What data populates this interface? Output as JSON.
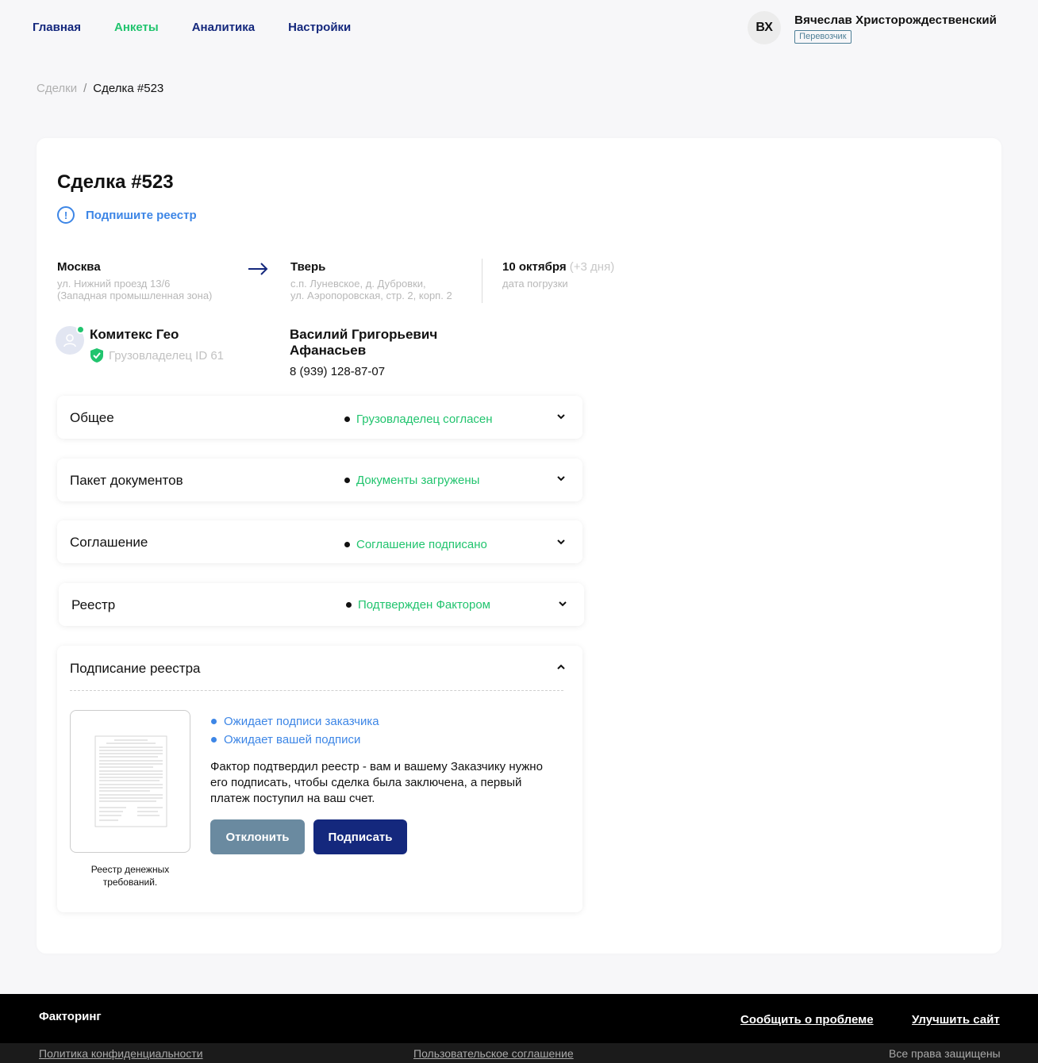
{
  "nav": {
    "items": [
      {
        "label": "Главная"
      },
      {
        "label": "Анкеты"
      },
      {
        "label": "Аналитика"
      },
      {
        "label": "Настройки"
      }
    ],
    "active_color": "#21c46e",
    "color": "#14287d"
  },
  "user": {
    "initials": "ВХ",
    "name": "Вячеслав  Христорождественский",
    "role": "Перевозчик"
  },
  "breadcrumb": {
    "parent": "Сделки",
    "separator": "/",
    "current": "Сделка #523"
  },
  "deal": {
    "title": "Сделка #523",
    "alert": "Подпишите реестр",
    "alert_icon": "exclamation-circle-icon",
    "route": {
      "from_city": "Москва",
      "from_addr_1": "ул. Нижний проезд 13/6",
      "from_addr_2": "(Западная промышленная зона)",
      "arrow_icon": "arrow-right-icon",
      "to_city": "Тверь",
      "to_addr_1": "с.п. Луневское, д. Дубровки,",
      "to_addr_2": "ул. Аэропоровская, стр. 2, корп. 2",
      "date": "10 октября",
      "date_plus": "(+3 дня)",
      "date_label": "дата погрузки"
    },
    "company": {
      "name": "Комитекс Гео",
      "role": "Грузовладелец ID 61",
      "verified_icon": "shield-check-icon"
    },
    "contact": {
      "name": "Василий Григорьевич Афанасьев",
      "phone": "8 (939) 128-87-07"
    }
  },
  "sections": [
    {
      "title": "Общее",
      "status": "Грузовладелец согласен"
    },
    {
      "title": "Пакет документов",
      "status": "Документы загружены"
    },
    {
      "title": "Соглашение",
      "status": "Соглашение подписано"
    },
    {
      "title": "Реестр",
      "status": "Подтвержден Фактором"
    }
  ],
  "signing": {
    "title": "Подписание реестра",
    "doc_caption": "Реестр денежных требований.",
    "statuses": [
      "Ожидает подписи заказчика",
      "Ожидает вашей подписи"
    ],
    "text": "Фактор подтвердил реестр - вам и вашему Заказчику нужно его подписать, чтобы сделка была заключена, а первый платеж поступил на ваш счет.",
    "decline_label": "Отклонить",
    "sign_label": "Подписать"
  },
  "footer": {
    "brand": "Факторинг",
    "report": "Сообщить о проблеме",
    "improve": "Улучшить сайт",
    "privacy": "Политика конфиденциальности",
    "agreement": "Пользовательское соглашение",
    "rights": "Все права защищены"
  },
  "colors": {
    "green": "#21c46e",
    "navy": "#14287d",
    "blue": "#3d86e6",
    "decline": "#6a8aa0"
  }
}
